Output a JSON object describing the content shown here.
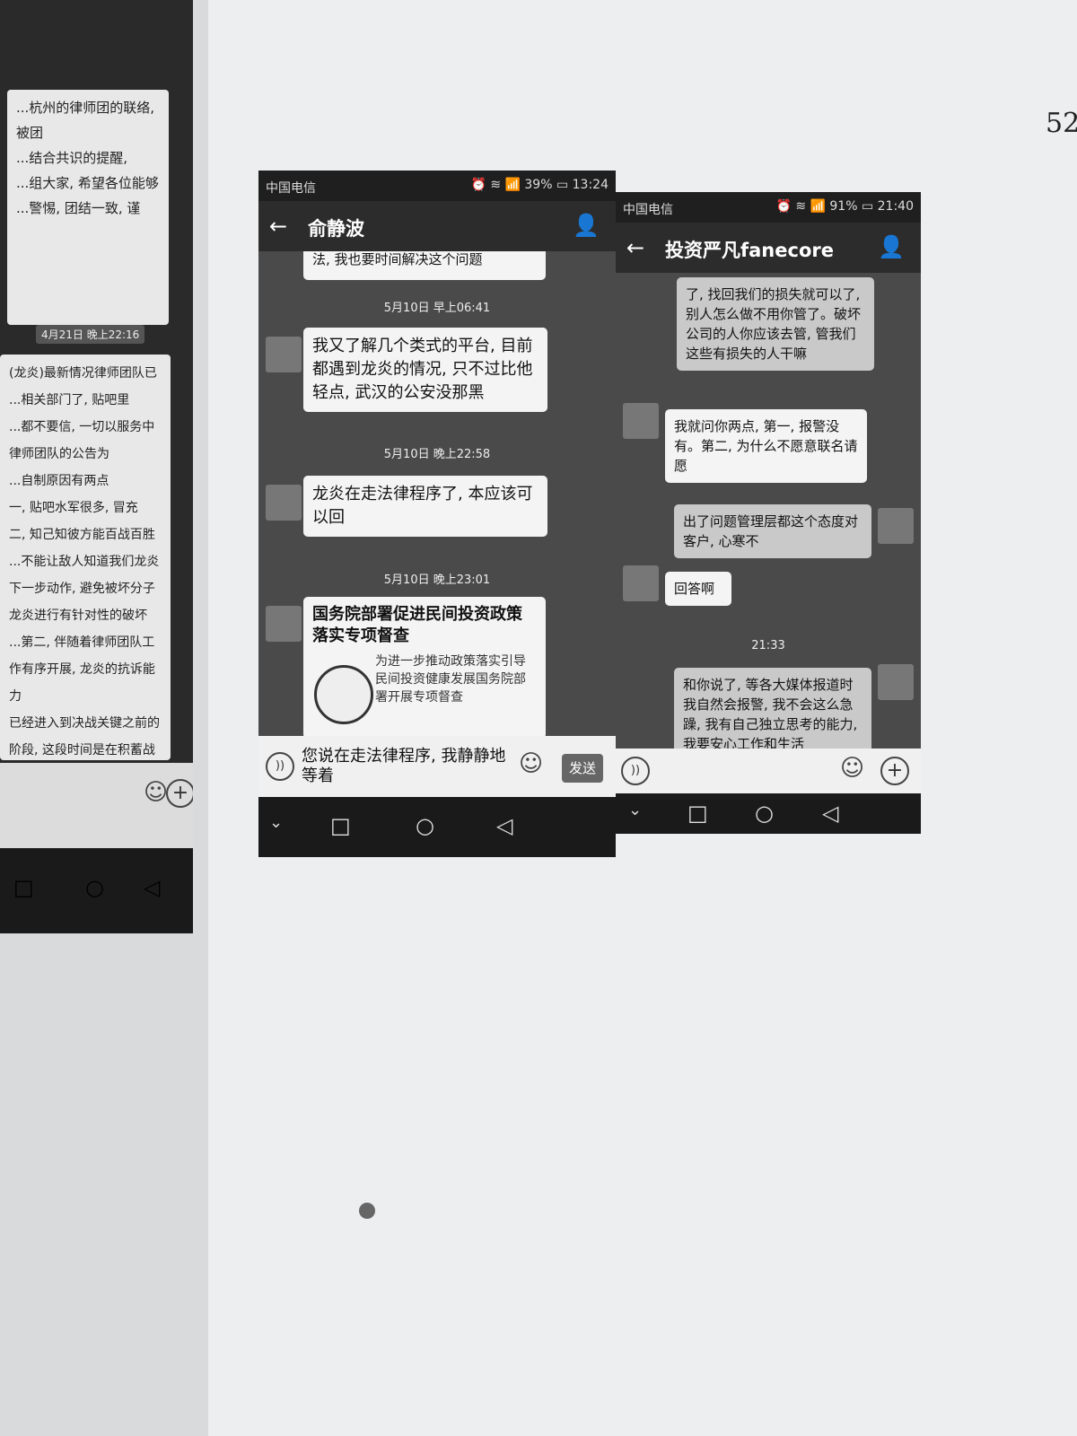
{
  "page_number": "52",
  "left_partial_screen": {
    "blocks": [
      "...杭州的律师团的联络, 被团",
      "...结合共识的提醒,",
      "...组大家, 希望各位能够",
      "...警惕, 团结一致, 谨"
    ],
    "time": "4月21日 晚上22:16",
    "blocks2": [
      "(龙炎)最新情况律师团队已",
      "...相关部门了, 贴吧里",
      "...都不要信, 一切以服务中",
      "律师团队的公告为",
      "...自制原因有两点",
      "一, 贴吧水军很多, 冒充",
      "二, 知己知彼方能百战百胜",
      "...不能让敌人知道我们龙炎",
      "下一步动作, 避免被坏分子",
      "龙炎进行有针对性的破坏",
      "...第二, 伴随着律师团队工",
      "作有序开展, 龙炎的抗诉能力",
      "已经进入到决战关键之前的",
      "阶段, 这段时间是在积蓄战斗"
    ]
  },
  "phone1": {
    "status": {
      "carrier": "中国电信",
      "right": "⏰ ≋ 📶 39% ▭ 13:24"
    },
    "title": "俞静波",
    "partial_top": "法, 我也要时间解决这个问题",
    "messages": [
      {
        "time": "5月10日 早上06:41",
        "text": "我又了解几个类式的平台, 目前都遇到龙炎的情况, 只不过比他轻点, 武汉的公安没那黑"
      },
      {
        "time": "5月10日 晚上22:58",
        "text": "龙炎在走法律程序了, 本应该可以回"
      },
      {
        "time": "5月10日 晚上23:01",
        "card_title": "国务院部署促进民间投资政策落实专项督查",
        "card_desc": "为进一步推动政策落实引导民间投资健康发展国务院部署开展专项督查"
      }
    ],
    "input_text": "您说在走法律程序, 我静静地等着",
    "send_label": "发送"
  },
  "phone2": {
    "status": {
      "carrier": "中国电信",
      "right": "⏰ ≋ 📶 91% ▭ 21:40"
    },
    "title": "投资严凡fanecore",
    "messages": [
      {
        "text": "了, 找回我们的损失就可以了, 别人怎么做不用你管了。破坏公司的人你应该去管, 管我们这些有损失的人干嘛"
      },
      {
        "text": "我就问你两点, 第一, 报警没有。第二, 为什么不愿意联名请愿"
      },
      {
        "text": "出了问题管理层都这个态度对客户, 心寒不"
      },
      {
        "text": "回答啊"
      },
      {
        "time": "21:33"
      },
      {
        "text": "和你说了, 等各大媒体报道时我自然会报警, 我不会这么急躁, 我有自己独立思考的能力, 我要安心工作和生活"
      }
    ]
  },
  "colors": {
    "bubble": "#f4f4f4",
    "chat_bg": "#4a4a4a",
    "bar": "#2c2c2c"
  }
}
